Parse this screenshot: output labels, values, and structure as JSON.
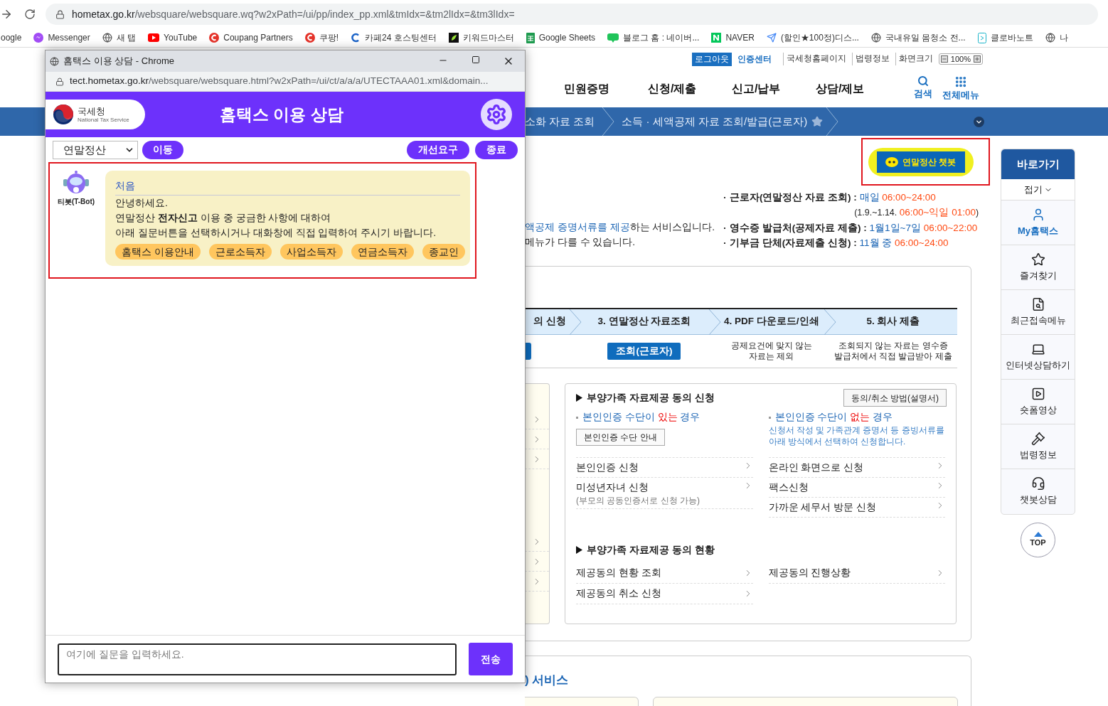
{
  "browser": {
    "url_host": "hometax.go.kr",
    "url_path": "/websquare/websquare.wq?w2xPath=/ui/pp/index_pp.xml&tmIdx=&tm2lIdx=&tm3lIdx=",
    "bookmarks": [
      "oogle",
      "Messenger",
      "새 탭",
      "YouTube",
      "Coupang Partners",
      "쿠팡!",
      "카페24 호스팅센터",
      "키워드마스터",
      "Google Sheets",
      "블로그 홈 : 네이버...",
      "NAVER",
      "(할인★100정)디스...",
      "국내유일 몸청소 전...",
      "클로바노트",
      "나"
    ]
  },
  "page": {
    "utility": [
      {
        "label": "로그아웃",
        "kind": "button"
      },
      {
        "label": "인증센터",
        "kind": "strong"
      },
      {
        "label": "국세청홈페이지",
        "kind": "link"
      },
      {
        "label": "법령정보",
        "kind": "link"
      },
      {
        "label": "화면크기",
        "kind": "link"
      }
    ],
    "zoom": "100%",
    "nav": [
      "민원증명",
      "신청/제출",
      "신고/납부",
      "상담/제보"
    ],
    "nav_tools": [
      "검색",
      "전체메뉴"
    ],
    "breadcrumb": [
      "소화 자료 조회",
      "소득 · 세액공제 자료 조회/발급(근로자)"
    ],
    "chatbot_button": "연말정산 챗봇",
    "intro": {
      "highlight": "액공제 증명서류를 제공",
      "rest": "하는 서비스입니다.",
      "line2": "메뉴가 다를 수 있습니다."
    },
    "schedule": [
      {
        "kind": "main",
        "label": "근로자(연말정산 자료 조회) :",
        "day": "매일",
        "time": "06:00~24:00"
      },
      {
        "kind": "note",
        "label": "(1.9.~1.14.",
        "time": "06:00~익일 01:00",
        "suffix": ")"
      },
      {
        "kind": "main",
        "label": "영수증 발급처(공제자료 제출) :",
        "day": "1월1일~7일",
        "time": "06:00~22:00"
      },
      {
        "kind": "main",
        "label": "기부금 단체(자료제출 신청) :",
        "day": "11월 중",
        "time": "06:00~24:00"
      }
    ],
    "steps": [
      "의 신청",
      "3. 연말정산 자료조회",
      "4. PDF 다운로드/인쇄",
      "5. 회사 제출"
    ],
    "step_actions": [
      {
        "kind": "edge"
      },
      {
        "kind": "button",
        "label": "조회(근로자)"
      },
      {
        "kind": "text",
        "label": "공제요건에 맞지 않는\n자료는 제외"
      },
      {
        "kind": "text",
        "label": "조회되지 않는 자료는 영수증\n발급처에서 직접 발급받아 제출"
      }
    ],
    "consent": {
      "title": "부양가족 자료제공 동의 신청",
      "guide_button": "동의/취소 방법(설명서)",
      "columns": [
        {
          "heading": {
            "pre": "본인인증 수단이 ",
            "em": "있는",
            "post": " 경우"
          },
          "button": "본인인증 수단 안내",
          "links": [
            {
              "label": "본인인증 신청"
            },
            {
              "label": "미성년자녀 신청",
              "note": "(부모의 공동인증서로 신청 가능)"
            }
          ]
        },
        {
          "heading": {
            "pre": "본인인증 수단이 ",
            "em": "없는",
            "post": " 경우"
          },
          "desc": "신청서 작성 및 가족관계 증명서 등 증빙서류를\n아래 방식에서 선택하여 신청합니다.",
          "links": [
            {
              "label": "온라인 화면으로 신청"
            },
            {
              "label": "팩스신청"
            },
            {
              "label": "가까운 세무서 방문 신청"
            }
          ]
        }
      ]
    },
    "status": {
      "title": "부양가족 자료제공 동의 현황",
      "columns": [
        [
          "제공동의 현황 조회",
          "제공동의 취소 신청"
        ],
        [
          "제공동의 진행상황"
        ]
      ]
    },
    "bottom_title": ") 서비스",
    "sidebar": {
      "title": "바로가기",
      "collapse": "접기",
      "items": [
        {
          "label": "My홈택스",
          "selected": true
        },
        {
          "label": "즐겨찾기",
          "selected": false
        },
        {
          "label": "최근접속메뉴",
          "selected": false
        },
        {
          "label": "인터넷상담하기",
          "selected": false
        },
        {
          "label": "숏폼영상",
          "selected": false
        },
        {
          "label": "법령정보",
          "selected": false
        },
        {
          "label": "챗봇상담",
          "selected": false
        }
      ],
      "top": "TOP"
    }
  },
  "popup": {
    "title": "홈택스 이용 상담 - Chrome",
    "url_host": "tect.hometax.go.kr",
    "url_path": "/websquare/websquare.html?w2xPath=/ui/ct/a/a/a/UTECTAAA01.xml&domain...",
    "org": "국세청",
    "org_en": "National Tax Service",
    "header": "홈택스 이용 상담",
    "select": "연말정산",
    "move": "이동",
    "actions": [
      "개선요구",
      "종료"
    ],
    "bot_name": "티봇(T-Bot)",
    "message": {
      "title": "처음",
      "lines": [
        "안녕하세요.",
        "연말정산 **전자신고** 이용 중 궁금한 사항에 대하여",
        "아래 질문버튼을 선택하시거나 대화창에 직접 입력하여 주시기 바랍니다."
      ],
      "quick_replies": [
        "홈택스 이용안내",
        "근로소득자",
        "사업소득자",
        "연금소득자",
        "종교인"
      ]
    },
    "input_placeholder": "여기에 질문을 입력하세요.",
    "send": "전송"
  }
}
